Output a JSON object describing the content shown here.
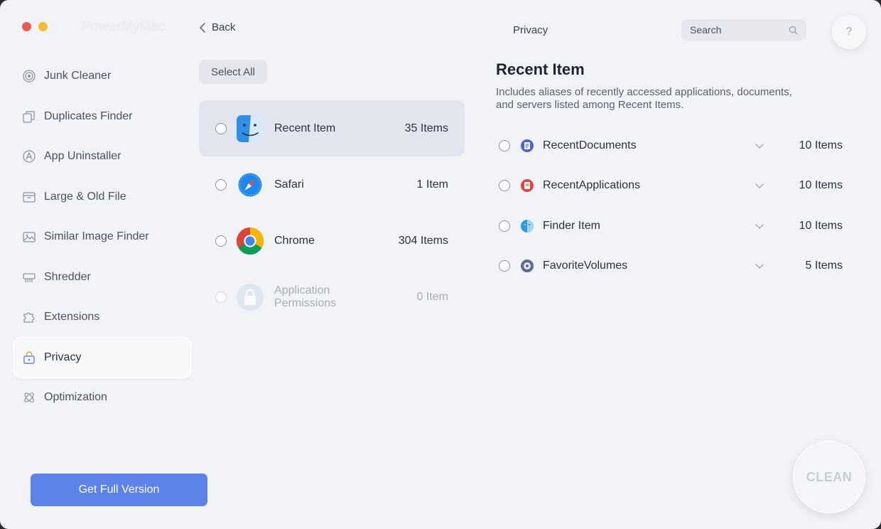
{
  "window": {
    "app_title": "PowerMyMac",
    "page_title": "Privacy"
  },
  "nav": {
    "back_label": "Back"
  },
  "search": {
    "placeholder": "Search"
  },
  "help": {
    "label": "?"
  },
  "sidebar": {
    "items": [
      {
        "label": "Junk Cleaner",
        "icon": "junk-cleaner-icon"
      },
      {
        "label": "Duplicates Finder",
        "icon": "duplicates-icon"
      },
      {
        "label": "App Uninstaller",
        "icon": "app-uninstaller-icon"
      },
      {
        "label": "Large & Old File",
        "icon": "large-file-icon"
      },
      {
        "label": "Similar Image Finder",
        "icon": "image-icon"
      },
      {
        "label": "Shredder",
        "icon": "shredder-icon"
      },
      {
        "label": "Extensions",
        "icon": "extensions-icon"
      },
      {
        "label": "Privacy",
        "icon": "privacy-icon",
        "active": true
      },
      {
        "label": "Optimization",
        "icon": "optimization-icon"
      }
    ],
    "cta_label": "Get Full Version"
  },
  "middle": {
    "select_all_label": "Select All",
    "rows": [
      {
        "name": "Recent Item",
        "count": "35 Items",
        "icon": "finder-icon",
        "selected": true
      },
      {
        "name": "Safari",
        "count": "1 Item",
        "icon": "safari-icon"
      },
      {
        "name": "Chrome",
        "count": "304 Items",
        "icon": "chrome-icon"
      },
      {
        "name": "Application Permissions",
        "count": "0 Item",
        "icon": "lock-icon",
        "disabled": true
      }
    ]
  },
  "detail": {
    "title": "Recent Item",
    "description": "Includes aliases of recently accessed applications, documents, and servers listed among Recent Items.",
    "rows": [
      {
        "name": "RecentDocuments",
        "count": "10 Items",
        "icon": "recent-documents-icon",
        "color": "#4f63d8"
      },
      {
        "name": "RecentApplications",
        "count": "10 Items",
        "icon": "recent-applications-icon",
        "color": "#e0463e"
      },
      {
        "name": "Finder Item",
        "count": "10 Items",
        "icon": "finder-item-icon",
        "color": "#2f9be0"
      },
      {
        "name": "FavoriteVolumes",
        "count": "5 Items",
        "icon": "favorite-volumes-icon",
        "color": "#5b6b95"
      }
    ]
  },
  "clean_label": "CLEAN",
  "colors": {
    "accent": "#5d82ea",
    "selected_row": "#e2e5ed",
    "background": "#f2f3f6"
  }
}
